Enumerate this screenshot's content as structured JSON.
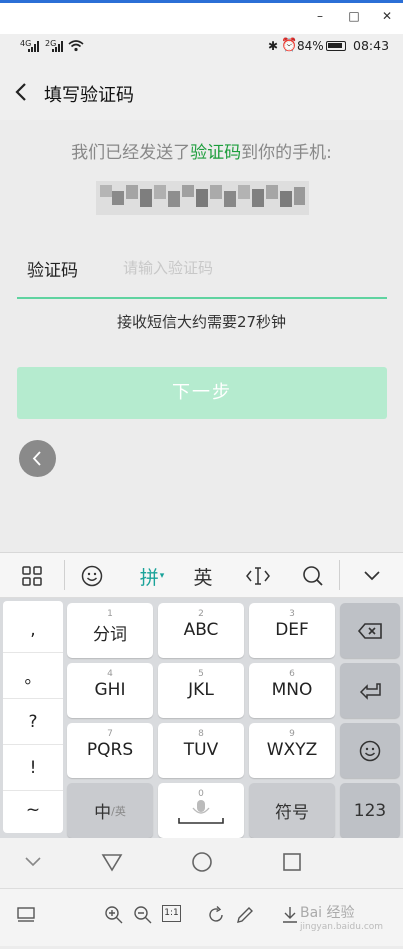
{
  "window": {
    "minimize": "–",
    "maximize": "□",
    "close": "✕"
  },
  "status": {
    "signal1": "4G",
    "signal2": "2G",
    "battery_pct": "84%",
    "time": "08:43"
  },
  "header": {
    "title": "填写验证码"
  },
  "content": {
    "sent_prefix": "我们已经发送了",
    "sent_highlight": "验证码",
    "sent_suffix": "到你的手机:",
    "code_label": "验证码",
    "code_placeholder": "请输入验证码",
    "sms_wait": "接收短信大约需要27秒钟",
    "next_button": "下一步"
  },
  "keyboard": {
    "toolbar": {
      "pinyin": "拼",
      "english": "英"
    },
    "punctuation": [
      ",",
      "。",
      "?",
      "!",
      "~"
    ],
    "rows": [
      [
        {
          "num": "1",
          "label": "分词"
        },
        {
          "num": "2",
          "label": "ABC"
        },
        {
          "num": "3",
          "label": "DEF"
        }
      ],
      [
        {
          "num": "4",
          "label": "GHI"
        },
        {
          "num": "5",
          "label": "JKL"
        },
        {
          "num": "6",
          "label": "MNO"
        }
      ],
      [
        {
          "num": "7",
          "label": "PQRS"
        },
        {
          "num": "8",
          "label": "TUV"
        },
        {
          "num": "9",
          "label": "WXYZ"
        }
      ]
    ],
    "zh_key": "中",
    "zh_key_sub": "/英",
    "space_num": "0",
    "symbol_key": "符号",
    "num_key": "123"
  },
  "bottom": {
    "zoom_reset": "1:1",
    "watermark": "Bai 经验",
    "watermark_sub": "jingyan.baidu.com"
  },
  "colors": {
    "accent": "#1d9e3c",
    "underline": "#5fd3a0",
    "next_btn": "#b5ebcf",
    "pinyin": "#1aa39a"
  }
}
